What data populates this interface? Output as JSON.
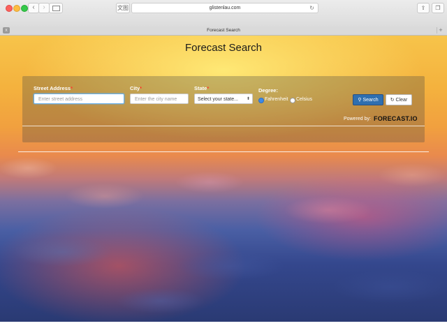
{
  "browser": {
    "url": "glistenlau.com",
    "tab_title": "Forecast Search",
    "reader_label": "文图",
    "back_glyph": "‹",
    "forward_glyph": "›",
    "reload_glyph": "↻",
    "share_glyph": "⇪",
    "tabs_glyph": "❐",
    "new_tab_glyph": "+",
    "close_tab_glyph": "x"
  },
  "page": {
    "title": "Forecast Search"
  },
  "form": {
    "street": {
      "label": "Street Address",
      "required_mark": "*",
      "placeholder": "Enter street address",
      "value": ""
    },
    "city": {
      "label": "City",
      "required_mark": "*",
      "placeholder": "Enter the city name",
      "value": ""
    },
    "state": {
      "label": "State",
      "required_mark": "*",
      "selected": "Select your state..."
    },
    "degree": {
      "label": "Degree",
      "required_mark": ":",
      "options": [
        {
          "label": "Fahrenheit",
          "checked": true
        },
        {
          "label": "Celsius",
          "checked": false
        }
      ]
    },
    "search_button": {
      "icon": "search-icon",
      "label": "Search"
    },
    "clear_button": {
      "icon": "refresh-icon",
      "label": "Clear"
    },
    "powered_by": "Powered by:",
    "logo_text": "FORECAST.IO"
  },
  "colors": {
    "search_button": "#2f6fb0",
    "required": "#ff3b30",
    "radio_checked": "#3d8ae8"
  }
}
